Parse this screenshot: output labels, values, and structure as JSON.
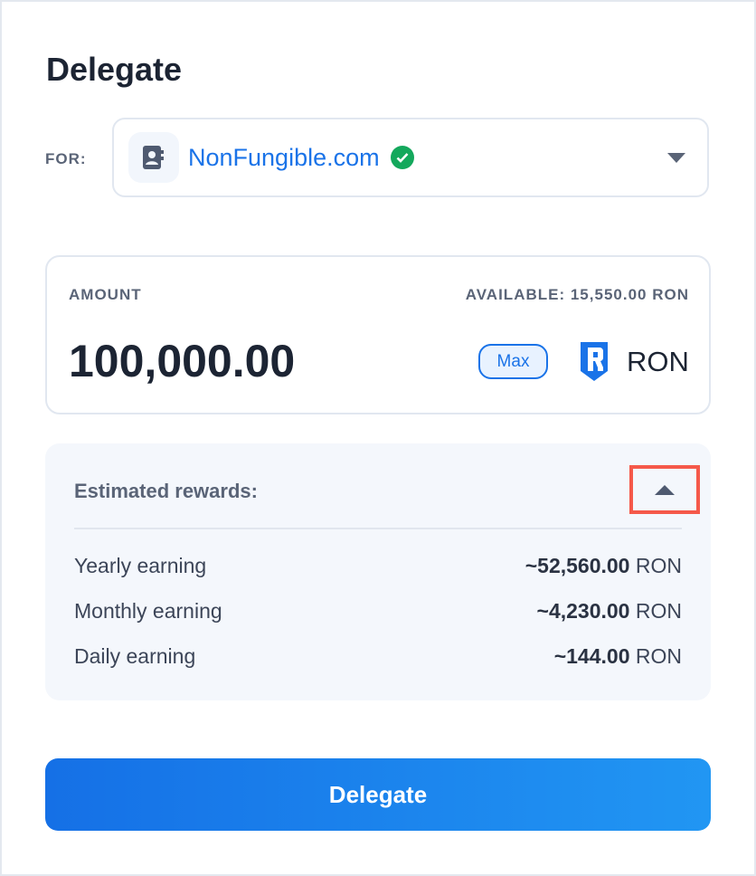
{
  "title": "Delegate",
  "for": {
    "label": "FOR:",
    "validator": "NonFungible.com",
    "verified": true,
    "icon": "contact-book-icon"
  },
  "amount": {
    "label": "AMOUNT",
    "available": "AVAILABLE: 15,550.00 RON",
    "value": "100,000.00",
    "max_label": "Max",
    "token": "RON"
  },
  "rewards": {
    "title": "Estimated rewards:",
    "rows": [
      {
        "label": "Yearly earning",
        "value": "~52,560.00",
        "unit": "RON"
      },
      {
        "label": "Monthly earning",
        "value": "~4,230.00",
        "unit": "RON"
      },
      {
        "label": "Daily earning",
        "value": "~144.00",
        "unit": "RON"
      }
    ]
  },
  "submit_label": "Delegate",
  "colors": {
    "accent": "#1a73e8",
    "verified": "#14a85c",
    "highlight": "#f5594a"
  }
}
